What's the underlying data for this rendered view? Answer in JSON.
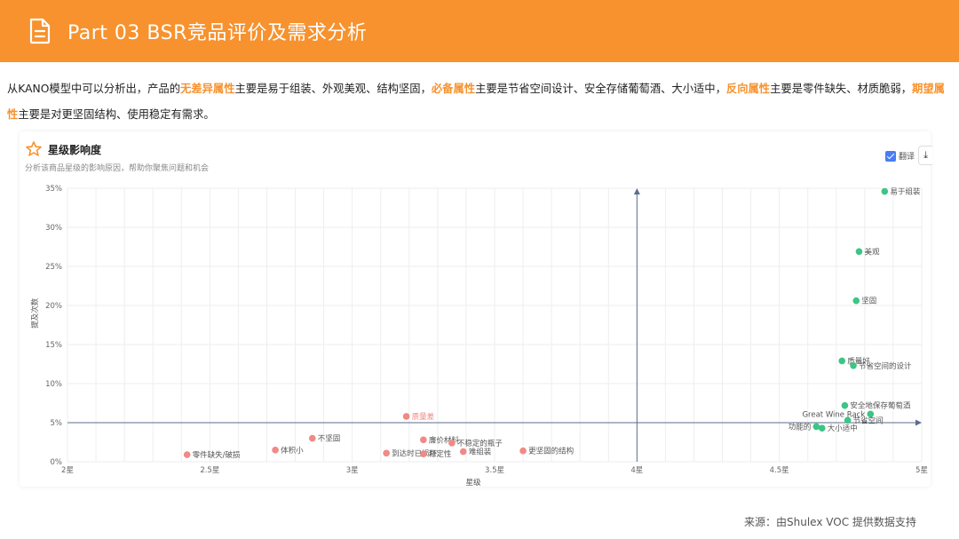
{
  "header": {
    "title": "Part 03  BSR竞品评价及需求分析",
    "icon": "document-icon",
    "bg_color": "#f7922e"
  },
  "description": {
    "parts": [
      {
        "text": "从KANO模型中可以分析出，产品的",
        "highlight": false
      },
      {
        "text": "无差异属性",
        "highlight": true
      },
      {
        "text": "主要是易于组装、外观美观、结构坚固，",
        "highlight": false
      },
      {
        "text": "必备属性",
        "highlight": true
      },
      {
        "text": "主要是节省空间设计、安全存储葡萄酒、大小适中，",
        "highlight": false
      },
      {
        "text": "反向属性",
        "highlight": true
      },
      {
        "text": "主要是零件缺失、材质脆弱，",
        "highlight": false
      },
      {
        "text": "期望属性",
        "highlight": true
      },
      {
        "text": "主要是对更坚固结构、使用稳定有需求。",
        "highlight": false
      }
    ],
    "highlight_color": "#f7922e"
  },
  "card": {
    "title": "星级影响度",
    "subtitle": "分析该商品星级的影响原因，帮助你聚焦问题和机会",
    "translate_label": "翻译",
    "star_icon": "star-icon",
    "download_icon": "download-icon"
  },
  "chart_data": {
    "type": "scatter",
    "xlabel": "星级",
    "ylabel": "提及次数",
    "xlim": [
      2,
      5
    ],
    "ylim": [
      0,
      35
    ],
    "x_ticks": [
      2,
      2.5,
      3,
      3.5,
      4,
      4.5,
      5
    ],
    "x_tick_labels": [
      "2星",
      "2.5星",
      "3星",
      "3.5星",
      "4星",
      "4.5星",
      "5星"
    ],
    "y_ticks": [
      0,
      5,
      10,
      15,
      20,
      25,
      30,
      35
    ],
    "y_tick_labels": [
      "0%",
      "5%",
      "10%",
      "15%",
      "20%",
      "25%",
      "30%",
      "35%"
    ],
    "grid": true,
    "reference_lines": {
      "x": 4,
      "y": 5
    },
    "colors": {
      "positive": "#3cc584",
      "negative": "#f08a86",
      "axis": "#5b6e8c"
    },
    "points": [
      {
        "label": "易于组装",
        "x": 4.87,
        "y": 34.6,
        "group": "positive"
      },
      {
        "label": "美观",
        "x": 4.78,
        "y": 26.9,
        "group": "positive"
      },
      {
        "label": "坚固",
        "x": 4.77,
        "y": 20.6,
        "group": "positive"
      },
      {
        "label": "质量好",
        "x": 4.72,
        "y": 12.9,
        "group": "positive"
      },
      {
        "label": "节省空间的设计",
        "x": 4.76,
        "y": 12.3,
        "group": "positive"
      },
      {
        "label": "安全地保存葡萄酒",
        "x": 4.73,
        "y": 7.2,
        "group": "positive"
      },
      {
        "label": "Great Wine Rack",
        "x": 4.82,
        "y": 6.1,
        "group": "positive"
      },
      {
        "label": "节省空间",
        "x": 4.74,
        "y": 5.3,
        "group": "positive"
      },
      {
        "label": "功能的",
        "x": 4.63,
        "y": 4.5,
        "group": "positive"
      },
      {
        "label": "大小适中",
        "x": 4.65,
        "y": 4.3,
        "group": "positive"
      },
      {
        "label": "质量差",
        "x": 3.19,
        "y": 5.8,
        "group": "negative"
      },
      {
        "label": "不坚固",
        "x": 2.86,
        "y": 3.0,
        "group": "negative"
      },
      {
        "label": "廉价材料",
        "x": 3.25,
        "y": 2.8,
        "group": "negative"
      },
      {
        "label": "不稳定的瓶子",
        "x": 3.35,
        "y": 2.4,
        "group": "negative"
      },
      {
        "label": "体积小",
        "x": 2.73,
        "y": 1.5,
        "group": "negative"
      },
      {
        "label": "更坚固的结构",
        "x": 3.6,
        "y": 1.4,
        "group": "negative"
      },
      {
        "label": "难组装",
        "x": 3.39,
        "y": 1.3,
        "group": "negative"
      },
      {
        "label": "到达时已损坏",
        "x": 3.12,
        "y": 1.1,
        "group": "negative"
      },
      {
        "label": "稳定性",
        "x": 3.25,
        "y": 1.0,
        "group": "negative"
      },
      {
        "label": "零件缺失/破损",
        "x": 2.42,
        "y": 0.9,
        "group": "negative"
      }
    ]
  },
  "source": "来源：由Shulex VOC 提供数据支持"
}
